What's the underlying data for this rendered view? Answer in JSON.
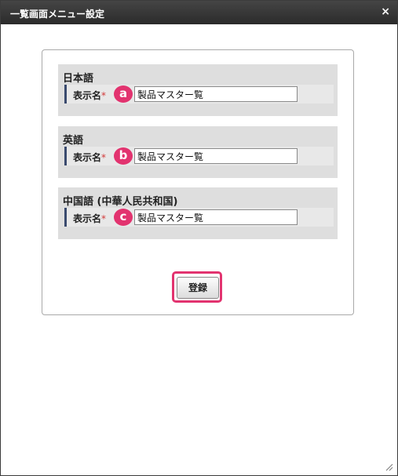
{
  "dialog": {
    "title": "一覧画面メニュー設定",
    "close_icon": "×"
  },
  "sections": [
    {
      "heading": "日本語",
      "field_label": "表示名",
      "required_mark": "*",
      "badge": "a",
      "value": "製品マスター覧"
    },
    {
      "heading": "英語",
      "field_label": "表示名",
      "required_mark": "*",
      "badge": "b",
      "value": "製品マスター覧"
    },
    {
      "heading": "中国語 (中華人民共和国)",
      "field_label": "表示名",
      "required_mark": "*",
      "badge": "c",
      "value": "製品マスター覧"
    }
  ],
  "actions": {
    "register_label": "登録"
  },
  "colors": {
    "accent": "#e2336f",
    "titlebar": "#333333",
    "section_bg": "#dedede"
  }
}
